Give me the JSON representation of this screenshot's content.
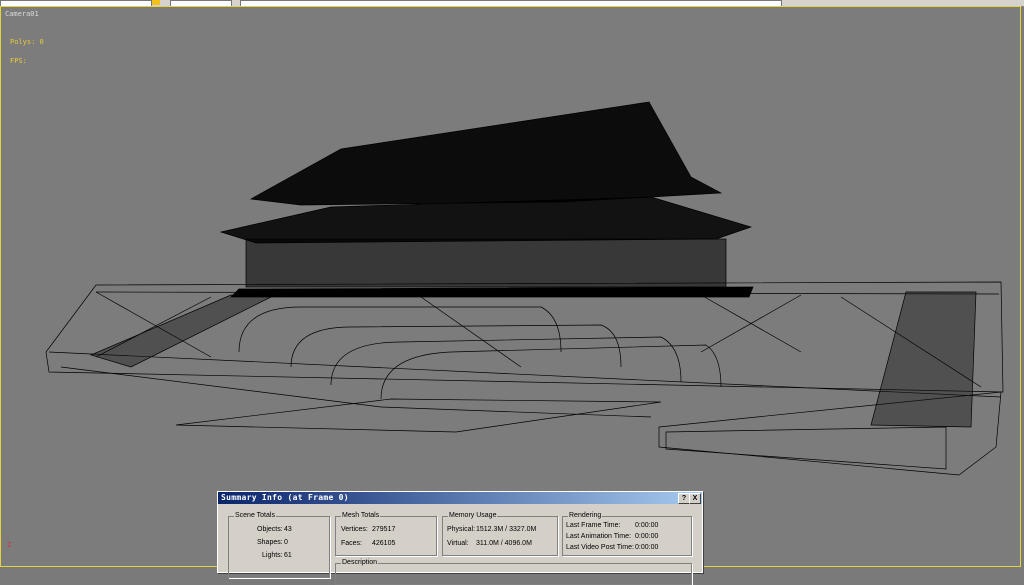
{
  "viewport": {
    "label": "Camera01",
    "polys": "Polys: 0",
    "fps": "FPS:",
    "axis": "Z"
  },
  "colors": {
    "viewport_bg": "#7c7c7c",
    "stats": "#e7cc3a",
    "titlebar": "#0a246a"
  },
  "dialog": {
    "title": "Summary Info (at Frame 0)",
    "help_btn": "?",
    "close_btn": "X",
    "scene_totals": {
      "header": "Scene Totals",
      "objects_label": "Objects:",
      "objects_value": "43",
      "shapes_label": "Shapes:",
      "shapes_value": "0",
      "lights_label": "Lights:",
      "lights_value": "61"
    },
    "mesh_totals": {
      "header": "Mesh Totals",
      "vertices_label": "Vertices:",
      "vertices_value": "279517",
      "faces_label": "Faces:",
      "faces_value": "426105"
    },
    "memory": {
      "header": "Memory Usage",
      "physical_label": "Physical:",
      "physical_value": "1512.3M / 3327.0M",
      "virtual_label": "Virtual:",
      "virtual_value": "311.0M / 4096.0M"
    },
    "rendering": {
      "header": "Rendering",
      "last_frame_label": "Last Frame Time:",
      "last_frame_value": "0:00:00",
      "last_anim_label": "Last Animation Time:",
      "last_anim_value": "0:00:00",
      "last_video_label": "Last Video Post Time:",
      "last_video_value": "0:00:00"
    },
    "description_header": "Description"
  }
}
